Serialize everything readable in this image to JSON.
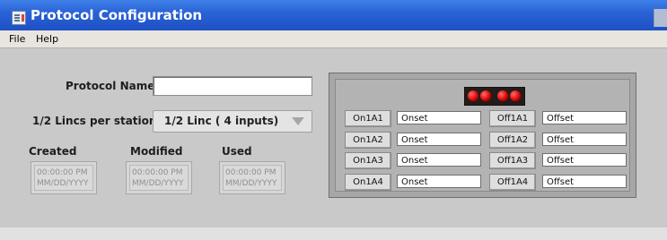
{
  "window": {
    "title": "Protocol Configuration"
  },
  "menu": {
    "items": [
      "File",
      "Help"
    ]
  },
  "protocol": {
    "name_label": "Protocol Name",
    "name_value": ""
  },
  "lincs": {
    "label": "1/2 Lincs per station",
    "selected": "1/2 Linc ( 4 inputs)"
  },
  "dates": {
    "labels": [
      "Created",
      "Modified",
      "Used"
    ],
    "values": [
      {
        "time": "00:00:00 PM",
        "date": "MM/DD/YYYY"
      },
      {
        "time": "00:00:00 PM",
        "date": "MM/DD/YYYY"
      },
      {
        "time": "00:00:00 PM",
        "date": "MM/DD/YYYY"
      }
    ]
  },
  "panel": {
    "led_color": "#d70000",
    "rows": [
      {
        "on_button": "On1A1",
        "on_value": "Onset",
        "off_button": "Off1A1",
        "off_value": "Offset"
      },
      {
        "on_button": "On1A2",
        "on_value": "Onset",
        "off_button": "Off1A2",
        "off_value": "Offset"
      },
      {
        "on_button": "On1A3",
        "on_value": "Onset",
        "off_button": "Off1A3",
        "off_value": "Offset"
      },
      {
        "on_button": "On1A4",
        "on_value": "Onset",
        "off_button": "Off1A4",
        "off_value": "Offset"
      }
    ]
  }
}
